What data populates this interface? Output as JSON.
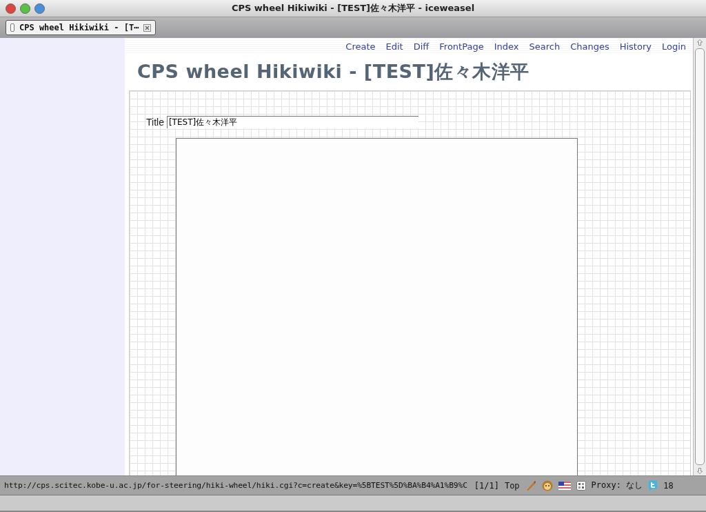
{
  "window": {
    "title": "CPS wheel Hikiwiki - [TEST]佐々木洋平 - iceweasel"
  },
  "tabs": [
    {
      "label": "CPS wheel Hikiwiki - [T⋯",
      "selected": true
    }
  ],
  "nav": [
    "Create",
    "Edit",
    "Diff",
    "FrontPage",
    "Index",
    "Search",
    "Changes",
    "History",
    "Login"
  ],
  "heading": "CPS wheel Hikiwiki - [TEST]佐々木洋平",
  "form": {
    "title_label": "Title",
    "title_value": "[TEST]佐々木洋平"
  },
  "status_bar": {
    "url": "http://cps.scitec.kobe-u.ac.jp/for-steering/hiki-wheel/hiki.cgi?c=create&key=%5BTEST%5D%BA%B4%A1%B9%C",
    "page": "[1/1]",
    "position": "Top",
    "proxy": "Proxy: なし",
    "count": "18"
  }
}
